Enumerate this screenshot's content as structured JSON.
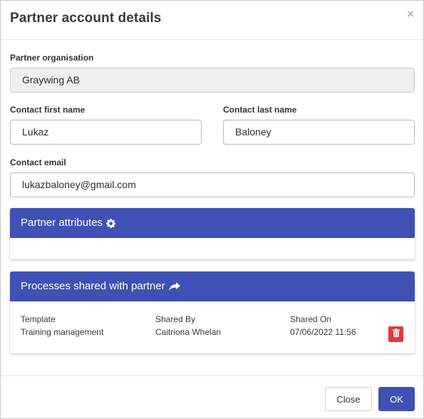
{
  "dialog": {
    "title": "Partner account details",
    "close_glyph": "×"
  },
  "form": {
    "organisation_label": "Partner organisation",
    "organisation_value": "Graywing AB",
    "first_name_label": "Contact first name",
    "first_name_value": "Lukaz",
    "last_name_label": "Contact last name",
    "last_name_value": "Baloney",
    "email_label": "Contact email",
    "email_value": "lukazbaloney@gmail.com"
  },
  "attributes_panel": {
    "title": "Partner attributes",
    "icon": "gear-icon"
  },
  "processes_panel": {
    "title": "Processes shared with partner",
    "icon": "share-icon",
    "columns": [
      "Template",
      "Shared By",
      "Shared On"
    ],
    "rows": [
      {
        "template": "Training management",
        "shared_by": "Caitriona Whelan",
        "shared_on": "07/06/2022 11:56",
        "action_icon": "trash-icon"
      }
    ]
  },
  "footer": {
    "close_label": "Close",
    "ok_label": "OK"
  },
  "colors": {
    "accent": "#3f51b5",
    "danger": "#e53935",
    "readonly_bg": "#edf0f2"
  }
}
